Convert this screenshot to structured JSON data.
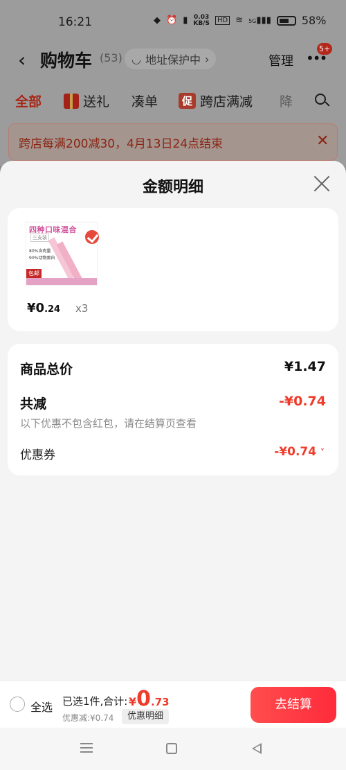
{
  "status_bar": {
    "time": "16:21",
    "net_speed_top": "0.03",
    "net_speed_bottom": "KB/S",
    "hd": "HD",
    "signal": "5G",
    "battery": "58%"
  },
  "header": {
    "title": "购物车",
    "count": "(53)",
    "address_protect": "地址保护中",
    "manage": "管理",
    "more_badge": "5+"
  },
  "tabs": [
    {
      "label": "全部"
    },
    {
      "label": "送礼"
    },
    {
      "label": "凑单"
    },
    {
      "label": "跨店满减",
      "tag": "促"
    },
    {
      "label": "降"
    }
  ],
  "promo_banner": {
    "text": "跨店每满200减30，4月13日24点结束"
  },
  "sheet": {
    "title": "金额明细",
    "product": {
      "thumb_title": "四种口味混合",
      "thumb_tag": "三支装",
      "thumb_line1": "80%含肉量",
      "thumb_line2": "90%动物蛋白",
      "thumb_badge": "包邮",
      "price_symbol": "¥",
      "price_int": "0",
      "price_dec": ".24",
      "quantity": "x3"
    },
    "summary": {
      "total_label": "商品总价",
      "total_value": "¥1.47",
      "reduce_label": "共减",
      "reduce_value": "-¥0.74",
      "note": "以下优惠不包含红包，请在结算页查看",
      "coupon_label": "优惠券",
      "coupon_value": "-¥0.74"
    }
  },
  "checkout": {
    "select_all": "全选",
    "selected_text": "已选1件,合计:",
    "total_symbol": "¥",
    "total_int": "0",
    "total_dec": ".73",
    "discount_text": "优惠减:¥0.74",
    "detail_button": "优惠明细",
    "checkout_button": "去结算"
  },
  "colors": {
    "accent_red": "#ef3b2a",
    "button_red": "#fe2b3b"
  }
}
